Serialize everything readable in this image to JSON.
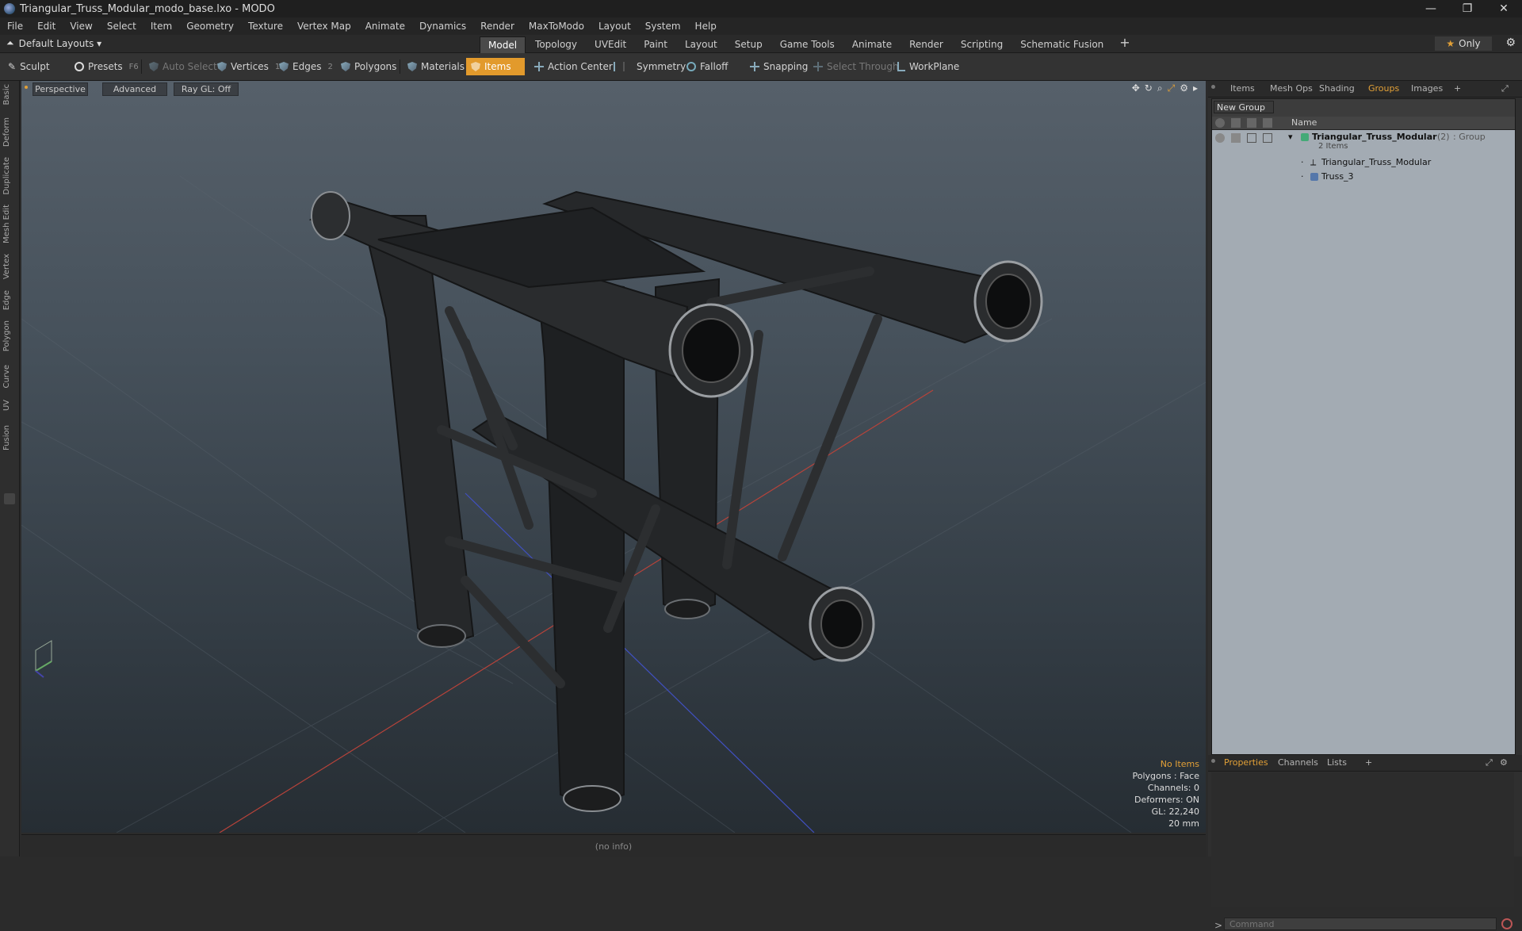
{
  "window": {
    "title": "Triangular_Truss_Modular_modo_base.lxo - MODO",
    "controls": [
      "—",
      "❐",
      "✕"
    ]
  },
  "menu": [
    "File",
    "Edit",
    "View",
    "Select",
    "Item",
    "Geometry",
    "Texture",
    "Vertex Map",
    "Animate",
    "Dynamics",
    "Render",
    "MaxToModo",
    "Layout",
    "System",
    "Help"
  ],
  "layoutbar": {
    "layout_label": "Default Layouts ▾",
    "tabs": [
      "Model",
      "Topology",
      "UVEdit",
      "Paint",
      "Layout",
      "Setup",
      "Game Tools",
      "Animate",
      "Render",
      "Scripting",
      "Schematic Fusion"
    ],
    "active_tab": "Model",
    "only_label": "Only"
  },
  "toolbar": {
    "sculpt": "Sculpt",
    "presets": "Presets",
    "presets_key": "F6",
    "auto_select": "Auto Select",
    "vertices": "Vertices",
    "vertices_count": "1",
    "edges": "Edges",
    "edges_count": "2",
    "polygons": "Polygons",
    "materials": "Materials",
    "items": "Items",
    "action_center": "Action Center",
    "symmetry": "Symmetry",
    "falloff": "Falloff",
    "snapping": "Snapping",
    "select_through": "Select Through",
    "workplane": "WorkPlane"
  },
  "leftstrip": [
    "Basic",
    "Deform",
    "Duplicate",
    "Mesh Edit",
    "Vertex",
    "Edge",
    "Polygon",
    "Curve",
    "UV",
    "Fusion"
  ],
  "viewport": {
    "view": "Perspective",
    "shading": "Advanced",
    "raygl": "Ray GL: Off",
    "info": {
      "selection": "No Items",
      "polygons": "Polygons : Face",
      "channels": "Channels: 0",
      "deformers": "Deformers: ON",
      "gl": "GL: 22,240",
      "scale": "20 mm"
    }
  },
  "status": "(no info)",
  "right_tabs": [
    "Items",
    "Mesh Ops",
    "Shading",
    "Groups",
    "Images"
  ],
  "right_active": "Groups",
  "groups": {
    "new_group": "New Group",
    "column_name": "Name",
    "root": {
      "name": "Triangular_Truss_Modular",
      "count": "(2)",
      "type": ": Group",
      "sub": "2 Items"
    },
    "children": [
      "Triangular_Truss_Modular",
      "Truss_3"
    ]
  },
  "bottom_tabs": [
    "Properties",
    "Channels",
    "Lists"
  ],
  "bottom_active": "Properties",
  "command": {
    "placeholder": "Command"
  },
  "colors": {
    "accent": "#e2a037",
    "panel": "#2f2f2f",
    "list_bg": "#a3abb3"
  }
}
